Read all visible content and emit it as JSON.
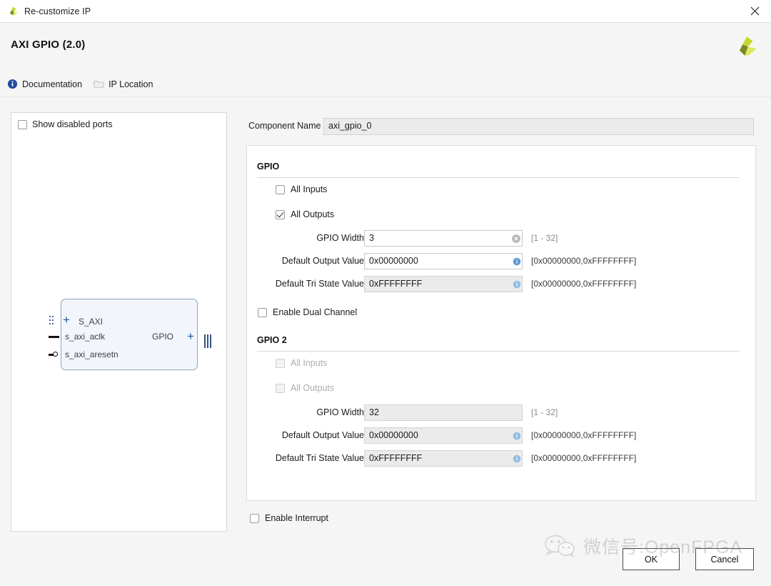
{
  "window": {
    "title": "Re-customize IP",
    "close_icon": "close-icon",
    "logo_icon": "xilinx-logo-icon"
  },
  "header": {
    "title": "AXI GPIO (2.0)",
    "logo_icon": "xilinx-logo-icon"
  },
  "toolbar": {
    "documentation_label": "Documentation",
    "documentation_icon": "info-circle-icon",
    "ip_location_label": "IP Location",
    "ip_location_icon": "folder-icon"
  },
  "left_panel": {
    "show_disabled_ports_label": "Show disabled ports",
    "show_disabled_ports_checked": false,
    "block": {
      "bus_port": "S_AXI",
      "clock_port": "s_axi_aclk",
      "reset_port": "s_axi_aresetn",
      "output_port": "GPIO",
      "expander": "+"
    }
  },
  "component": {
    "name_label": "Component Name",
    "name_value": "axi_gpio_0"
  },
  "gpio": {
    "group_title": "GPIO",
    "all_inputs_label": "All Inputs",
    "all_inputs_checked": false,
    "all_outputs_label": "All Outputs",
    "all_outputs_checked": true,
    "width_label": "GPIO Width",
    "width_value": "3",
    "width_hint": "[1 - 32]",
    "out_label": "Default Output Value",
    "out_value": "0x00000000",
    "out_hint": "[0x00000000,0xFFFFFFFF]",
    "tri_label": "Default Tri State Value",
    "tri_value": "0xFFFFFFFF",
    "tri_hint": "[0x00000000,0xFFFFFFFF]",
    "clear_icon": "clear-field-icon",
    "info_icon": "info-icon"
  },
  "dual_channel": {
    "label": "Enable Dual Channel",
    "checked": false
  },
  "gpio2": {
    "group_title": "GPIO 2",
    "all_inputs_label": "All Inputs",
    "all_inputs_checked": false,
    "all_outputs_label": "All Outputs",
    "all_outputs_checked": false,
    "width_label": "GPIO Width",
    "width_value": "32",
    "width_hint": "[1 - 32]",
    "out_label": "Default Output Value",
    "out_value": "0x00000000",
    "out_hint": "[0x00000000,0xFFFFFFFF]",
    "tri_label": "Default Tri State Value",
    "tri_value": "0xFFFFFFFF",
    "tri_hint": "[0x00000000,0xFFFFFFFF]",
    "info_icon": "info-icon"
  },
  "interrupt": {
    "label": "Enable Interrupt",
    "checked": false
  },
  "buttons": {
    "ok_label": "OK",
    "cancel_label": "Cancel"
  },
  "watermark": {
    "text": "微信号:OpenFPGA",
    "icon": "wechat-logo-icon"
  },
  "colors": {
    "accent_blue": "#1f4e9c",
    "logo_green": "#c4d82e",
    "logo_dark_green": "#7a8a1e",
    "panel_bg": "#ffffff",
    "window_bg": "#f5f5f5",
    "readonly_field": "#ebebeb"
  }
}
